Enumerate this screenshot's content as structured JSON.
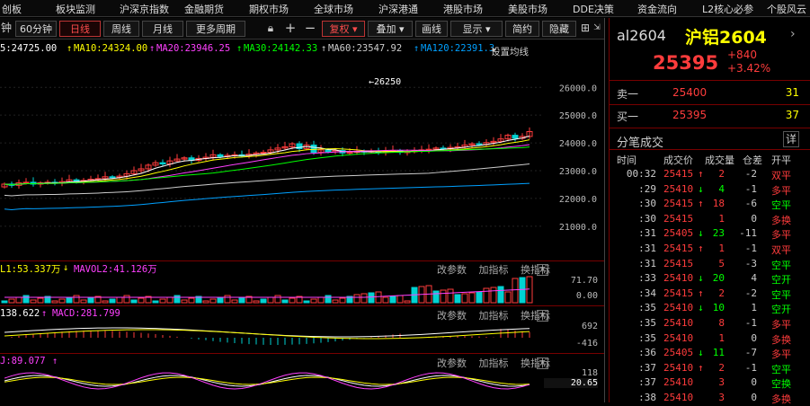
{
  "menu": [
    "创板",
    "板块监测",
    "沪深京指数",
    "金融期货",
    "期权市场",
    "全球市场",
    "沪深港通",
    "港股市场",
    "美股市场",
    "DDE决策",
    "资金流向",
    "L2核心必参",
    "个股风云"
  ],
  "toolbar": {
    "periods": [
      "钟",
      "60分钟",
      "日线",
      "周线",
      "月线",
      "更多周期"
    ],
    "active_period": "日线",
    "icons": [
      "lock-icon",
      "plus-icon",
      "minus-icon"
    ],
    "fuquan": "复权",
    "overlay": "叠加",
    "draw_line": "画线",
    "display": "显示",
    "simple": "简约",
    "hide": "隐藏"
  },
  "ma_line": {
    "ma5": "5:24725.00",
    "ma10": "MA10:24324.00",
    "ma20": "MA20:23946.25",
    "ma30": "MA30:24142.33",
    "ma60": "MA60:23547.92",
    "ma120": "MA120:22391.3",
    "settings": "设置均线"
  },
  "colors": {
    "up": "#ff3c3c",
    "down": "#00d2d2",
    "ma5": "#ffffff",
    "ma10": "#ffff00",
    "ma20": "#ff40ff",
    "ma30": "#00ff00",
    "ma60": "#cccccc",
    "ma120": "#00a0ff"
  },
  "price_axis": [
    "26000.0",
    "25000.0",
    "24000.0",
    "23000.0",
    "22000.0",
    "21000.0"
  ],
  "peak_label": "26250",
  "vol_panel": {
    "legend1": "L1:53.337万",
    "legend2": "MAVOL2:41.126万",
    "axis": [
      "71.70",
      "0.00"
    ]
  },
  "macd_panel": {
    "legend1": "138.622",
    "legend2": "MACD:281.799",
    "axis": [
      "692",
      "-416"
    ]
  },
  "kdj_panel": {
    "legend1": "J:89.077",
    "axis": [
      "118",
      "20.65"
    ]
  },
  "panel_buttons": [
    "改参数",
    "加指标",
    "换指标"
  ],
  "close_glyph": "×",
  "quote": {
    "code": "al2604",
    "name": "沪铝2604",
    "price": "25395",
    "change": "+840",
    "change_pct": "+3.42%",
    "sell_label": "卖一",
    "sell_price": "25400",
    "sell_qty": "31",
    "buy_label": "买一",
    "buy_price": "25395",
    "buy_qty": "37"
  },
  "ticks": {
    "title": "分笔成交",
    "detail": "详",
    "headers": [
      "时间",
      "成交价",
      "成交量",
      "仓差",
      "开平"
    ],
    "rows": [
      {
        "time": "00:32",
        "price": "25415",
        "dir": "↑",
        "vol": "2",
        "diff": "-2",
        "type": "双平"
      },
      {
        "time": ":29",
        "price": "25410",
        "dir": "↓",
        "vol": "4",
        "diff": "-1",
        "type": "多平"
      },
      {
        "time": ":30",
        "price": "25415",
        "dir": "↑",
        "vol": "18",
        "diff": "-6",
        "type": "空平"
      },
      {
        "time": ":30",
        "price": "25415",
        "dir": "",
        "vol": "1",
        "diff": "0",
        "type": "多换"
      },
      {
        "time": ":31",
        "price": "25405",
        "dir": "↓",
        "vol": "23",
        "diff": "-11",
        "type": "多平"
      },
      {
        "time": ":31",
        "price": "25415",
        "dir": "↑",
        "vol": "1",
        "diff": "-1",
        "type": "双平"
      },
      {
        "time": ":31",
        "price": "25415",
        "dir": "",
        "vol": "5",
        "diff": "-3",
        "type": "空平"
      },
      {
        "time": ":33",
        "price": "25410",
        "dir": "↓",
        "vol": "20",
        "diff": "4",
        "type": "空开"
      },
      {
        "time": ":34",
        "price": "25415",
        "dir": "↑",
        "vol": "2",
        "diff": "-2",
        "type": "空平"
      },
      {
        "time": ":35",
        "price": "25410",
        "dir": "↓",
        "vol": "10",
        "diff": "1",
        "type": "空开"
      },
      {
        "time": ":35",
        "price": "25410",
        "dir": "",
        "vol": "8",
        "diff": "-1",
        "type": "多平"
      },
      {
        "time": ":35",
        "price": "25410",
        "dir": "",
        "vol": "1",
        "diff": "0",
        "type": "多换"
      },
      {
        "time": ":36",
        "price": "25405",
        "dir": "↓",
        "vol": "11",
        "diff": "-7",
        "type": "多平"
      },
      {
        "time": ":37",
        "price": "25410",
        "dir": "↑",
        "vol": "2",
        "diff": "-1",
        "type": "空平"
      },
      {
        "time": ":37",
        "price": "25410",
        "dir": "",
        "vol": "3",
        "diff": "0",
        "type": "空换"
      },
      {
        "time": ":38",
        "price": "25410",
        "dir": "",
        "vol": "3",
        "diff": "0",
        "type": "多换"
      }
    ]
  }
}
